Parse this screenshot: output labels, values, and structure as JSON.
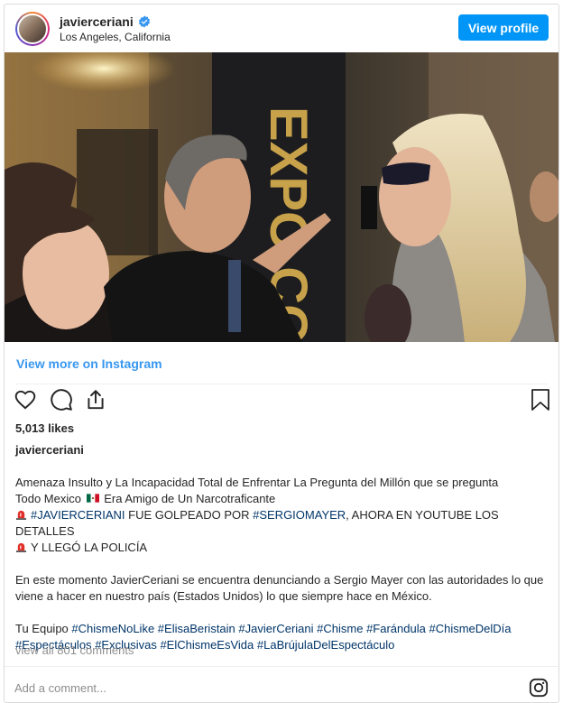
{
  "header": {
    "username": "javierceriani",
    "location": "Los Angeles, California",
    "view_profile_label": "View profile"
  },
  "photo": {
    "poster_text": "EXPO COM"
  },
  "view_more_label": "View more on Instagram",
  "likes": "5,013 likes",
  "caption": {
    "username": "javierceriani",
    "line1": "Amenaza Insulto y La Incapacidad Total de Enfrentar La Pregunta del Millón que se pregunta",
    "line2": "Todo Mexico",
    "line2b": "Era Amigo de Un Narcotraficante",
    "tag_javier": "#JAVIERCERIANI",
    "line3_mid": " FUE GOLPEADO POR ",
    "tag_sergio": "#SERGIOMAYER",
    "line3_end": ", AHORA EN YOUTUBE LOS DETALLES",
    "line4": "Y LLEGÓ LA POLICÍA",
    "para2": "En este momento JavierCeriani se encuentra denunciando a Sergio Mayer con las autoridades lo que viene a hacer en nuestro país (Estados Unidos) lo que siempre hace en México.",
    "team_prefix": "Tu Equipo ",
    "hashtags": [
      "#ChismeNoLike",
      "#ElisaBeristain",
      "#JavierCeriani",
      "#Chisme",
      "#Farándula",
      "#ChismeDelDía",
      "#Espectáculos",
      "#Exclusivas",
      "#ElChismeEsVida",
      "#LaBrújulaDelEspectáculo"
    ]
  },
  "comments_label": "view all 801 comments",
  "add_comment_placeholder": "Add a comment...",
  "colors": {
    "accent": "#0095f6",
    "link": "#3897f0",
    "hashtag": "#003569"
  },
  "icons": [
    "verified-badge-icon",
    "heart-icon",
    "comment-icon",
    "share-icon",
    "bookmark-icon",
    "instagram-icon",
    "siren-icon",
    "mexico-flag-icon"
  ]
}
